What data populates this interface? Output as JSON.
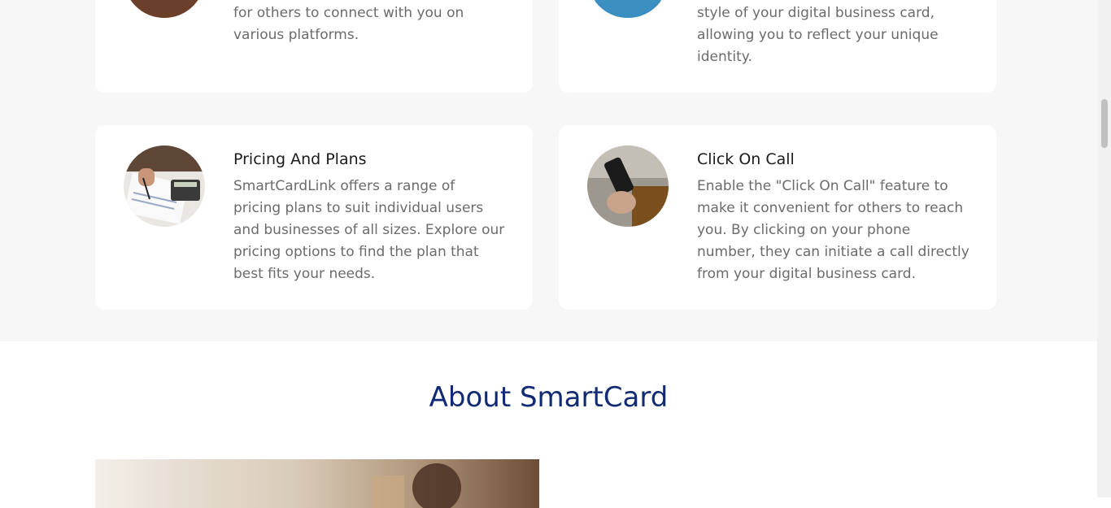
{
  "features": {
    "top_left": {
      "text": "for others to connect with you on various platforms.",
      "image_icon": "profile-photo-icon"
    },
    "top_right": {
      "text": "style of your digital business card, allowing you to reflect your unique identity.",
      "image_icon": "card-design-photo-icon"
    },
    "pricing": {
      "title": "Pricing And Plans",
      "text": "SmartCardLink offers a range of pricing plans to suit individual users and businesses of all sizes. Explore our pricing options to find the plan that best fits your needs.",
      "image_icon": "calculator-photo-icon"
    },
    "click_on_call": {
      "title": "Click On Call",
      "text": "Enable the \"Click On Call\" feature to make it convenient for others to reach you. By clicking on your phone number, they can initiate a call directly from your digital business card.",
      "image_icon": "phone-call-photo-icon"
    }
  },
  "about": {
    "title": "About SmartCard",
    "image_icon": "about-photo-icon"
  },
  "colors": {
    "section_bg": "#f7f7f7",
    "card_bg": "#ffffff",
    "heading": "#102a73",
    "body_text": "#6b6b6b"
  }
}
